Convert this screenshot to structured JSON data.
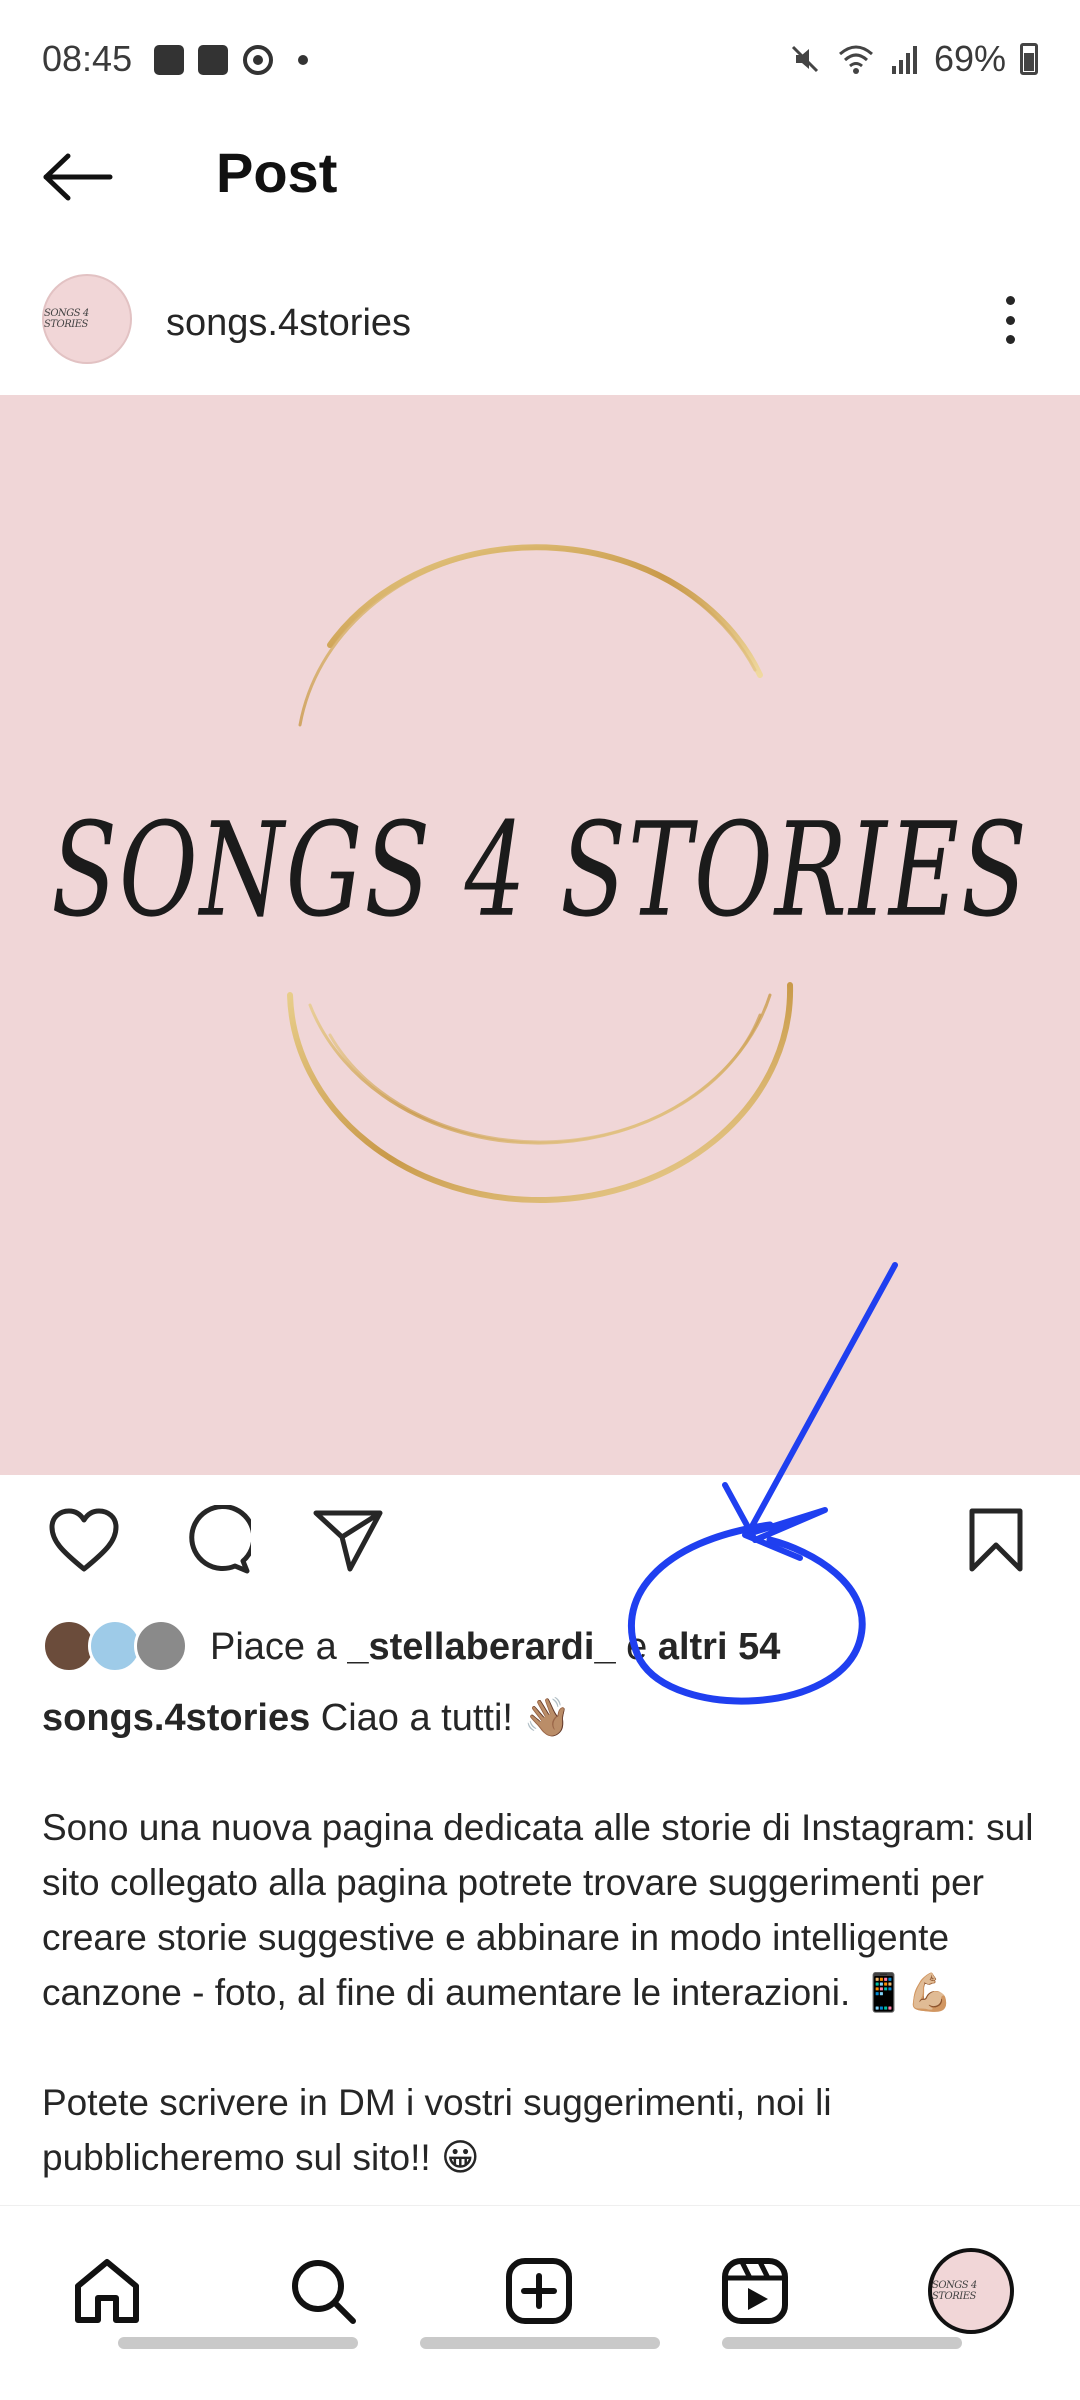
{
  "status_bar": {
    "time": "08:45",
    "battery": "69%",
    "icons_left": [
      "gallery-icon",
      "calendar-icon",
      "app-icon",
      "dot-icon"
    ],
    "icons_right": [
      "mute-icon",
      "wifi-icon",
      "signal-icon",
      "battery-icon"
    ]
  },
  "header": {
    "title": "Post",
    "back_icon": "back-arrow-icon"
  },
  "author": {
    "username": "songs.4stories",
    "avatar_text": "SONGS 4 STORIES"
  },
  "post_image": {
    "logo_text": "SONGS 4 STORIES",
    "background": "#f0d6d7",
    "ring_color": "#d4b06a"
  },
  "actions": [
    "heart-icon",
    "comment-icon",
    "share-icon",
    "bookmark-icon"
  ],
  "likes": {
    "prefix": "Piace a ",
    "user": "_stellaberardi_",
    "suffix_connector": " e ",
    "others": "altri 54"
  },
  "caption": {
    "username": "songs.4stories",
    "first_line": " Ciao a tutti! 👋🏽",
    "paragraph1": "Sono una nuova pagina dedicata alle storie di Instagram: sul sito collegato alla pagina potrete trovare suggerimenti per creare storie suggestive e abbinare in modo intelligente canzone - foto, al fine di aumentare le interazioni. 📱💪🏼",
    "paragraph2": "Potete scrivere in DM i vostri suggerimenti, noi li pubblicheremo sul sito!! 😀"
  },
  "annotation": {
    "color": "#1f3ff0"
  },
  "bottom_nav": [
    "home-icon",
    "search-icon",
    "create-icon",
    "reels-icon",
    "profile-avatar"
  ]
}
